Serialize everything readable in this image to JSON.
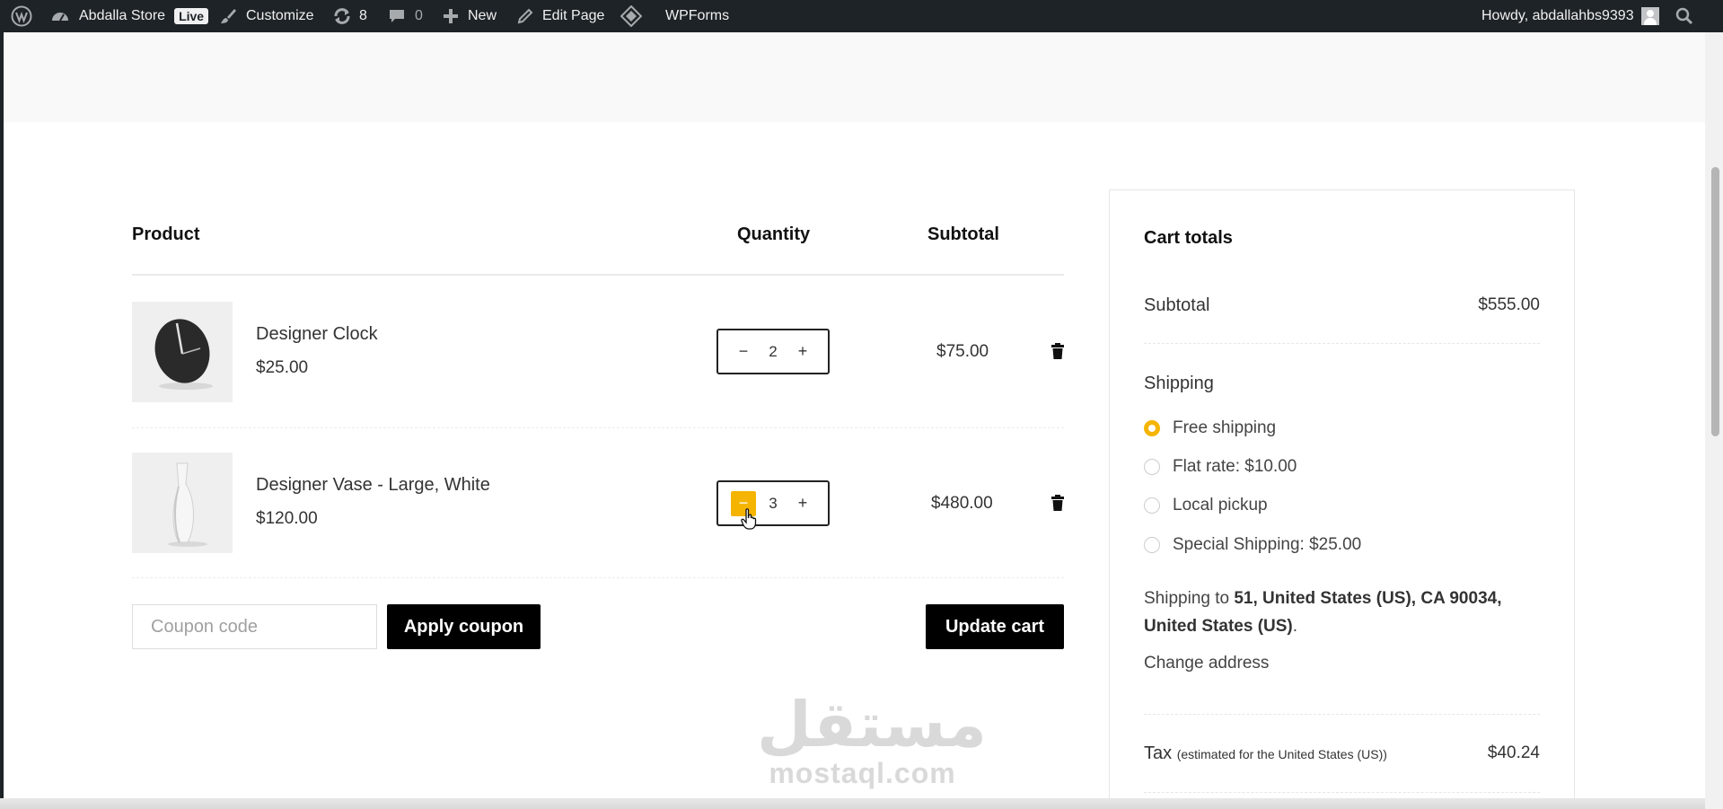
{
  "adminbar": {
    "site_name": "Abdalla Store",
    "live_badge": "Live",
    "customize": "Customize",
    "updates_count": "8",
    "comments_count": "0",
    "new": "New",
    "edit_page": "Edit Page",
    "wpforms": "WPForms",
    "howdy": "Howdy, abdallahbs9393"
  },
  "cart": {
    "headers": {
      "product": "Product",
      "quantity": "Quantity",
      "subtotal": "Subtotal"
    },
    "items": [
      {
        "name": "Designer Clock",
        "price": "$25.00",
        "quantity": "2",
        "subtotal": "$75.00",
        "image": "clock-image"
      },
      {
        "name": "Designer Vase - Large, White",
        "price": "$120.00",
        "quantity": "3",
        "subtotal": "$480.00",
        "image": "vase-image"
      }
    ],
    "coupon_placeholder": "Coupon code",
    "apply_coupon": "Apply coupon",
    "update_cart": "Update cart"
  },
  "totals": {
    "title": "Cart totals",
    "subtotal_label": "Subtotal",
    "subtotal_value": "$555.00",
    "shipping_label": "Shipping",
    "options": [
      "Free shipping",
      "Flat rate: $10.00",
      "Local pickup",
      "Special Shipping: $25.00"
    ],
    "selected_option": "Free shipping",
    "shipping_to_prefix": "Shipping to ",
    "shipping_to_address": "51, United States (US), CA 90034, United States (US)",
    "shipping_to_suffix": ".",
    "change_address": "Change address",
    "tax_label": "Tax",
    "tax_note": "(estimated for the United States (US))",
    "tax_value": "$40.24"
  },
  "watermark": {
    "arabic": "مستقل",
    "latin": "mostaql.com"
  },
  "colors": {
    "accent": "#f5b400",
    "adminbar": "#1d2327",
    "button": "#000000"
  }
}
